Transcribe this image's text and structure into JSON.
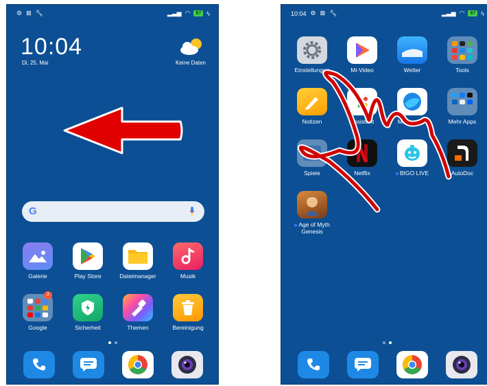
{
  "left": {
    "status": {
      "battery": "67"
    },
    "clock": "10:04",
    "date": "Di, 25. Mai",
    "weather_text": "Keine Daten",
    "search": {
      "logo": "G"
    },
    "apps": [
      {
        "label": "Galerie"
      },
      {
        "label": "Play Store"
      },
      {
        "label": "Dateimanager"
      },
      {
        "label": "Musik"
      },
      {
        "label": "Google",
        "badge": "2"
      },
      {
        "label": "Sicherheit"
      },
      {
        "label": "Themen"
      },
      {
        "label": "Bereinigung"
      }
    ],
    "gesture": "swipe-left-arrow"
  },
  "right": {
    "status": {
      "time": "10:04",
      "battery": "67"
    },
    "apps": [
      {
        "label": "Einstellungen"
      },
      {
        "label": "Mi-Video"
      },
      {
        "label": "Wetter"
      },
      {
        "label": "Tools"
      },
      {
        "label": "Notizen"
      },
      {
        "label": "Assistent"
      },
      {
        "label": "Mi Browser"
      },
      {
        "label": "Mehr Apps"
      },
      {
        "label": "Spiele"
      },
      {
        "label": "Netflix"
      },
      {
        "label": "BIGO LIVE"
      },
      {
        "label": "AutoDoc"
      },
      {
        "label": "Age of Myth Genesis"
      }
    ],
    "gesture": "tap-hand-outline"
  },
  "dock": [
    "phone-icon",
    "messages-icon",
    "chrome-icon",
    "camera-icon"
  ],
  "colors": {
    "background": "#0c4f94",
    "arrow": "#e00000"
  }
}
